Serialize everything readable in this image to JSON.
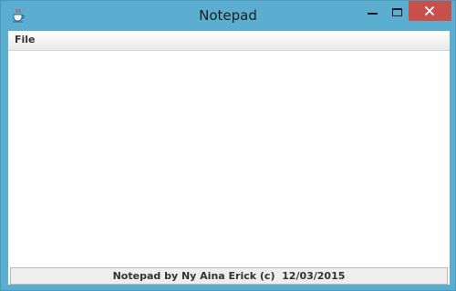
{
  "window": {
    "title": "Notepad"
  },
  "menubar": {
    "items": [
      {
        "label": "File"
      }
    ]
  },
  "editor": {
    "value": ""
  },
  "statusbar": {
    "text": "Notepad by Ny Aina Erick (c)  12/03/2015"
  },
  "icons": {
    "app": "java-coffee-cup-icon",
    "minimize": "minimize-icon",
    "maximize": "maximize-icon",
    "close": "close-icon"
  },
  "colors": {
    "frame": "#5baed0",
    "close_button": "#c7504a"
  }
}
